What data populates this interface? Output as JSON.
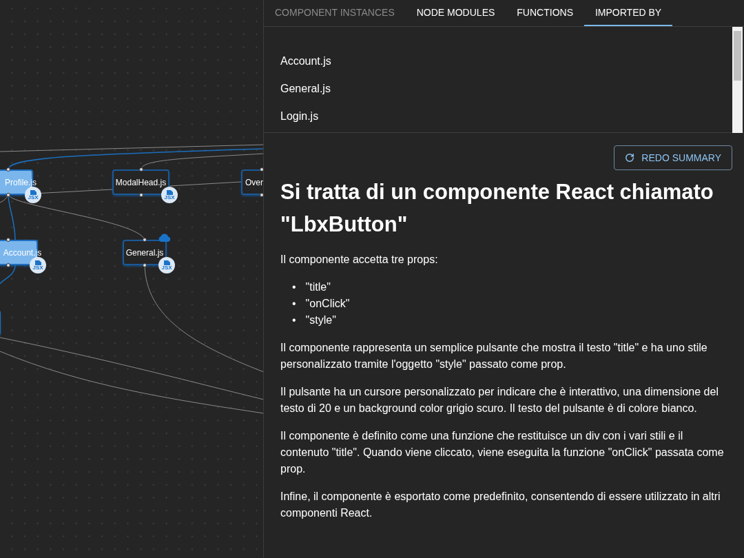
{
  "graph": {
    "nodes": [
      {
        "label": "Profile.js",
        "highlighted": true,
        "badge": "JSX",
        "cloud": false
      },
      {
        "label": "ModalHead.js",
        "highlighted": false,
        "badge": "JSX",
        "cloud": false
      },
      {
        "label": "Over",
        "highlighted": false,
        "cloud": false
      },
      {
        "label": "Account.js",
        "highlighted": true,
        "badge": "JSX",
        "cloud": false
      },
      {
        "label": "General.js",
        "highlighted": false,
        "badge": "JSX",
        "cloud": true
      },
      {
        "highlighted": true,
        "cloud": false
      }
    ]
  },
  "tabs": [
    {
      "label": "COMPONENT INSTANCES",
      "selected": false,
      "disabled": true
    },
    {
      "label": "NODE MODULES",
      "selected": false,
      "disabled": false
    },
    {
      "label": "FUNCTIONS",
      "selected": false,
      "disabled": false
    },
    {
      "label": "IMPORTED BY",
      "selected": true,
      "disabled": false
    }
  ],
  "imported_by": [
    "Account.js",
    "General.js",
    "Login.js"
  ],
  "summary": {
    "button": "REDO SUMMARY",
    "title": "Si tratta di un componente React chiamato \"LbxButton\"",
    "blocks": [
      {
        "kind": "paragraph",
        "text": "Il componente accetta tre props:"
      },
      {
        "kind": "list",
        "marker": "•",
        "items": [
          "\"title\"",
          "\"onClick\"",
          "\"style\""
        ]
      },
      {
        "kind": "paragraph",
        "text": "Il componente rappresenta un semplice pulsante che mostra il testo \"title\" e ha uno stile personalizzato tramite l'oggetto \"style\" passato come prop."
      },
      {
        "kind": "paragraph",
        "text": "Il pulsante ha un cursore personalizzato per indicare che è interattivo, una dimensione del testo di 20 e un background color grigio scuro. Il testo del pulsante è di colore bianco."
      },
      {
        "kind": "paragraph",
        "text": "Il componente è definito come una funzione che restituisce un div con i vari stili e il contenuto \"title\". Quando viene cliccato, viene eseguita la funzione \"onClick\" passata come prop."
      },
      {
        "kind": "paragraph",
        "text": "Infine, il componente è esportato come predefinito, consentendo di essere utilizzato in altri componenti React."
      }
    ]
  }
}
